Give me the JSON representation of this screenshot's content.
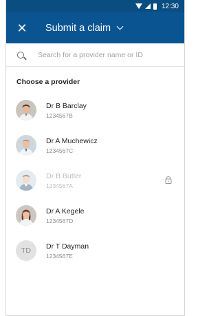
{
  "status_bar": {
    "time": "12:30"
  },
  "header": {
    "title": "Submit a claim",
    "close_icon": "close-icon",
    "dropdown_icon": "chevron-down-icon"
  },
  "search": {
    "placeholder": "Search for a provider name or ID",
    "icon": "search-icon"
  },
  "section_title": "Choose a provider",
  "providers": [
    {
      "name": "Dr B Barclay",
      "id": "1234567B",
      "avatar": "photo",
      "disabled": false
    },
    {
      "name": "Dr A Muchewicz",
      "id": "1234567C",
      "avatar": "photo",
      "disabled": false
    },
    {
      "name": "Dr B Butler",
      "id": "1234567A",
      "avatar": "photo",
      "disabled": true,
      "icon": "lock-icon"
    },
    {
      "name": "Dr A Kegele",
      "id": "1234567D",
      "avatar": "photo",
      "disabled": false
    },
    {
      "name": "Dr T Dayman",
      "id": "1234567E",
      "avatar": "initials",
      "initials": "TD",
      "disabled": false
    }
  ],
  "colors": {
    "status_bar": "#0a4d80",
    "app_bar": "#0a5591",
    "disabled_text": "#bcbcbc"
  }
}
